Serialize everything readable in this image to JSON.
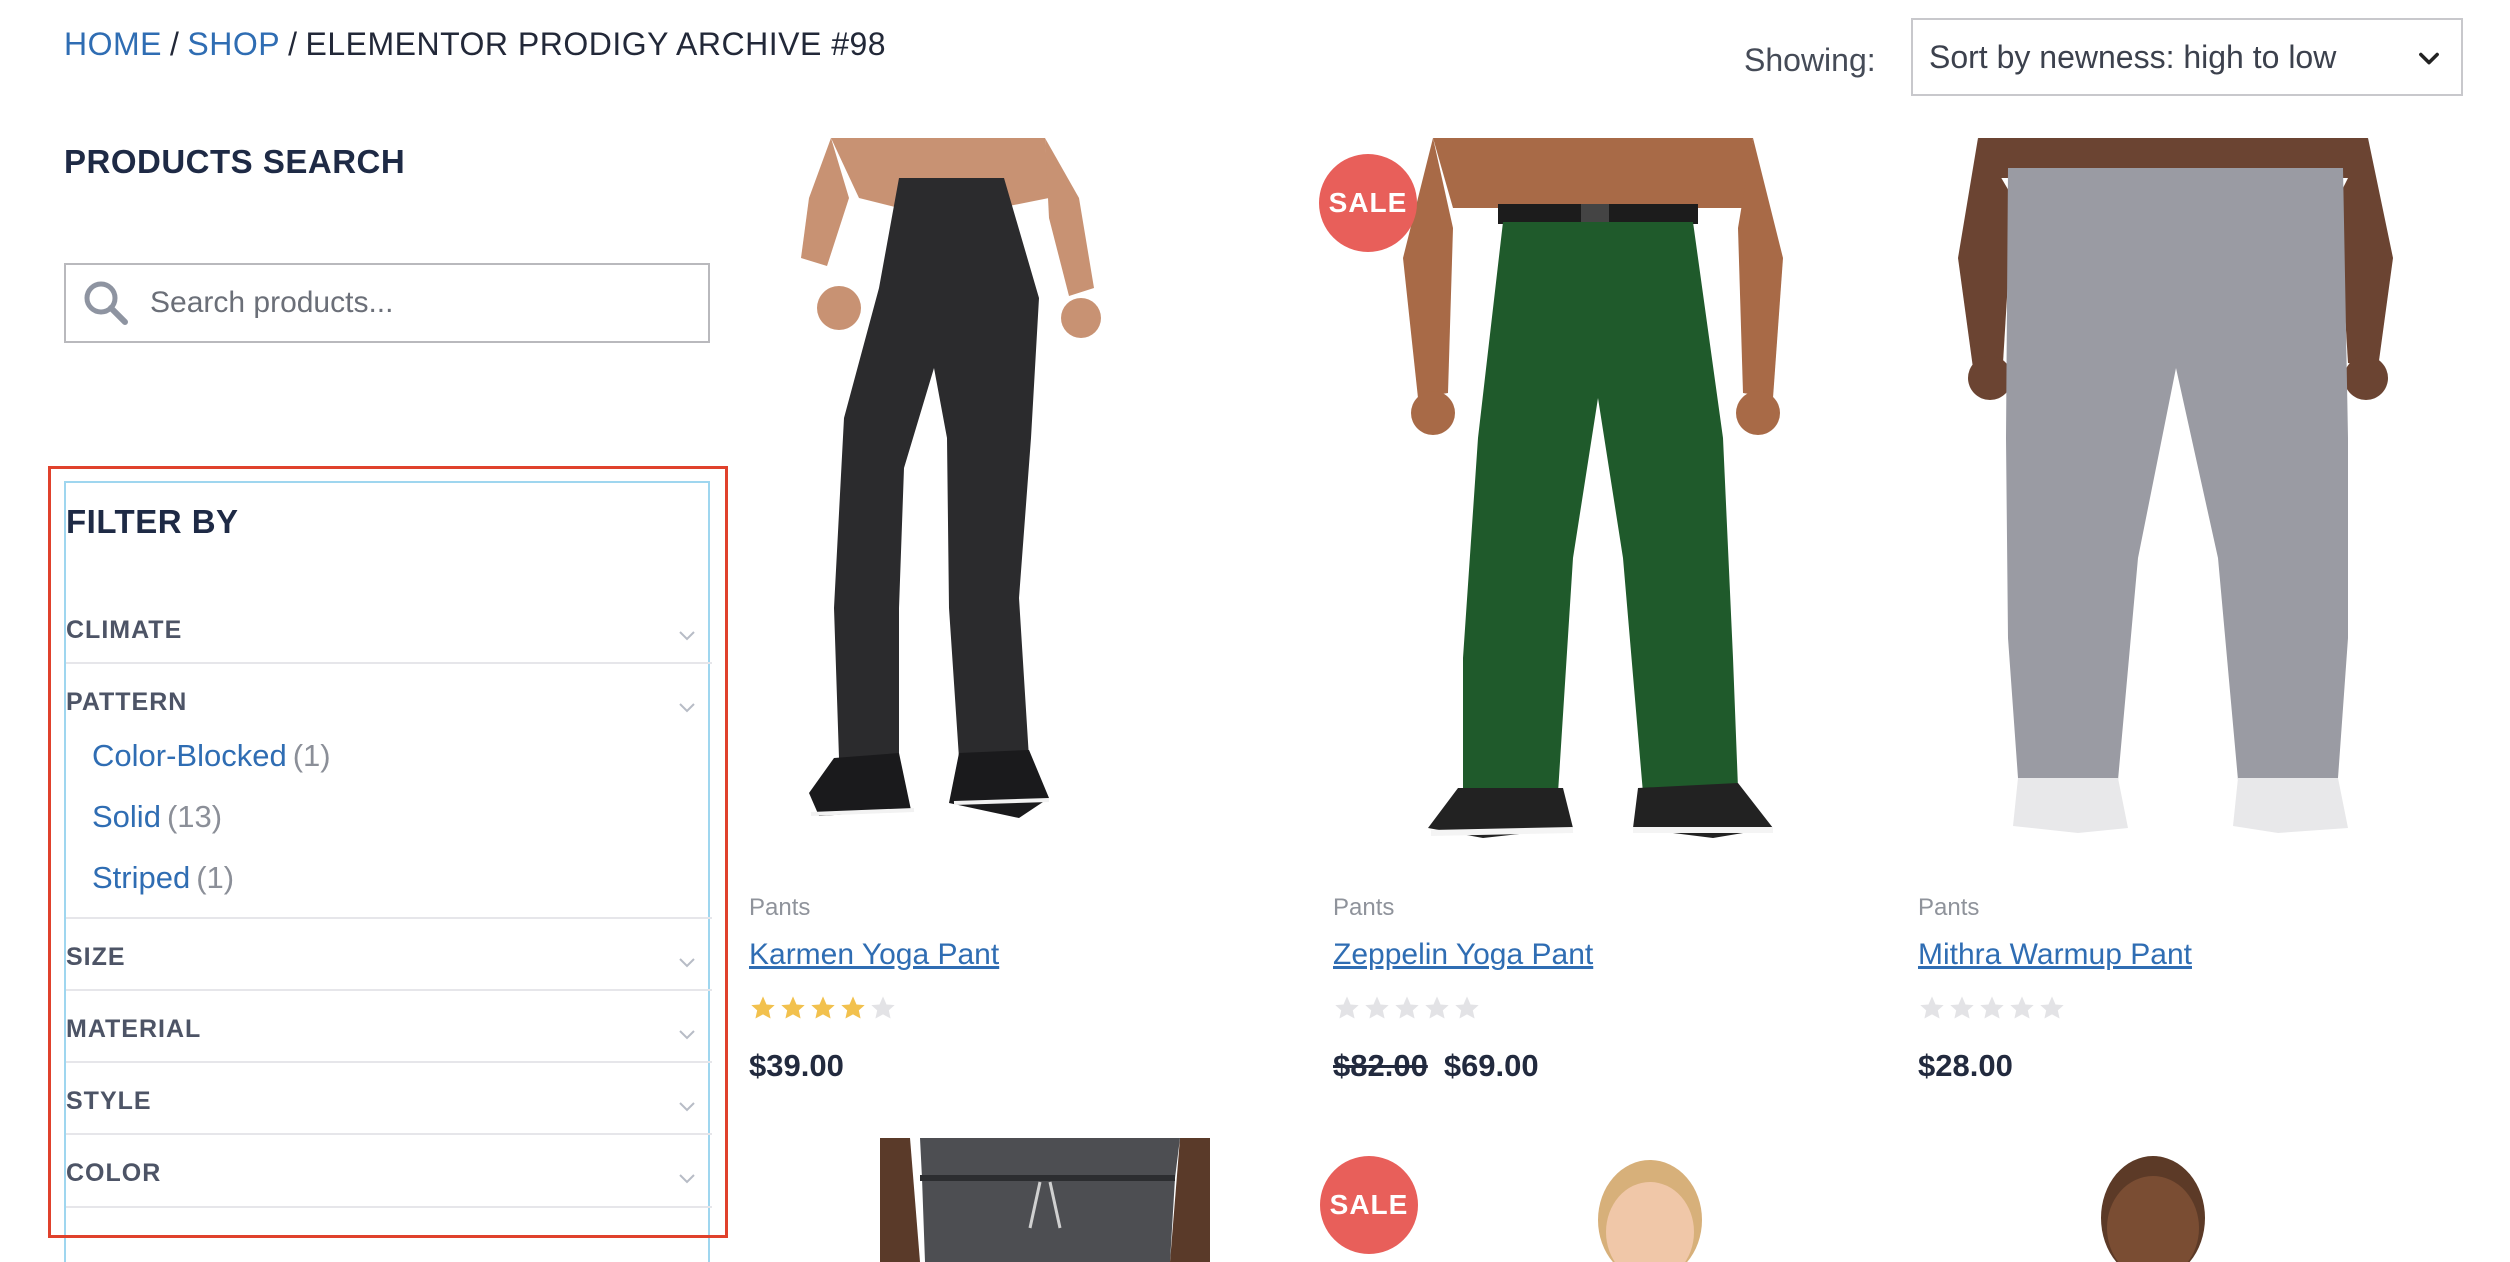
{
  "breadcrumb": {
    "home": "HOME",
    "shop": "SHOP",
    "current": "ELEMENTOR PRODIGY ARCHIVE #98",
    "separator": "/"
  },
  "sorting": {
    "label": "Showing:",
    "selected": "Sort by newness: high to low"
  },
  "sidebar": {
    "search_title": "PRODUCTS SEARCH",
    "search_placeholder": "Search products...",
    "filter_title": "FILTER BY",
    "facets": [
      {
        "label": "CLIMATE"
      },
      {
        "label": "PATTERN",
        "options": [
          {
            "name": "Color-Blocked",
            "count": "(1)"
          },
          {
            "name": "Solid",
            "count": "(13)"
          },
          {
            "name": "Striped",
            "count": "(1)"
          }
        ]
      },
      {
        "label": "SIZE"
      },
      {
        "label": "MATERIAL"
      },
      {
        "label": "STYLE"
      },
      {
        "label": "COLOR"
      }
    ]
  },
  "products": [
    {
      "category": "Pants",
      "name": "Karmen Yoga Pant",
      "rating": 4,
      "rating_max": 5,
      "price": "$39.00",
      "old_price": ""
    },
    {
      "category": "Pants",
      "name": "Zeppelin Yoga Pant",
      "rating": 0,
      "rating_max": 5,
      "price": "$69.00",
      "old_price": "$82.00",
      "badge": "SALE"
    },
    {
      "category": "Pants",
      "name": "Mithra Warmup Pant",
      "rating": 0,
      "rating_max": 5,
      "price": "$28.00",
      "old_price": ""
    }
  ],
  "row2": {
    "badge": "SALE"
  },
  "colors": {
    "link": "#2f6db3",
    "sale": "#e85f5a",
    "star_filled": "#f2c14e",
    "star_empty": "#e3e3e6",
    "highlight": "#e0412c"
  }
}
